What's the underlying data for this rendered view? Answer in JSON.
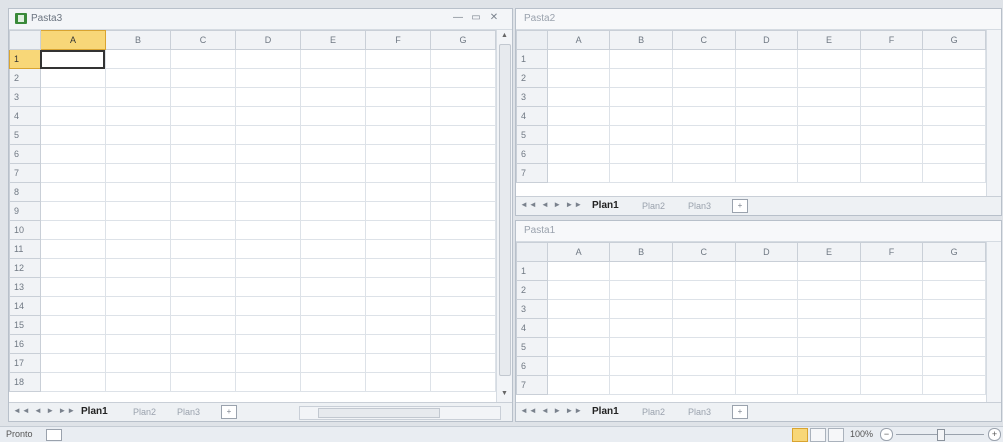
{
  "windows": [
    {
      "title": "Pasta3",
      "columns": [
        "A",
        "B",
        "C",
        "D",
        "E",
        "F",
        "G"
      ],
      "rows": [
        "1",
        "2",
        "3",
        "4",
        "5",
        "6",
        "7",
        "8",
        "9",
        "10",
        "11",
        "12",
        "13",
        "14",
        "15",
        "16",
        "17",
        "18"
      ],
      "sheet_tabs": [
        "Plan1",
        "Plan2",
        "Plan3"
      ],
      "active_tab": "Plan1",
      "selected_cell": "A1",
      "controls": {
        "minimize": "—",
        "restore": "▭",
        "close": "✕"
      }
    },
    {
      "title": "Pasta2",
      "columns": [
        "A",
        "B",
        "C",
        "D",
        "E",
        "F",
        "G"
      ],
      "rows": [
        "1",
        "2",
        "3",
        "4",
        "5",
        "6",
        "7"
      ],
      "sheet_tabs": [
        "Plan1",
        "Plan2",
        "Plan3"
      ],
      "active_tab": "Plan1"
    },
    {
      "title": "Pasta1",
      "columns": [
        "A",
        "B",
        "C",
        "D",
        "E",
        "F",
        "G"
      ],
      "rows": [
        "1",
        "2",
        "3",
        "4",
        "5",
        "6",
        "7"
      ],
      "sheet_tabs": [
        "Plan1",
        "Plan2",
        "Plan3"
      ],
      "active_tab": "Plan1"
    }
  ],
  "status": {
    "mode": "Pronto",
    "zoom": "100%",
    "zoom_minus": "−",
    "zoom_plus": "+"
  },
  "icons": {
    "tab_nav": "◄◄ ◄ ► ►►",
    "new_sheet": "insert-sheet-icon",
    "workbook": "excel-workbook-icon"
  },
  "colors": {
    "selected_header": "#f8d778",
    "workbook_icon": "#3a8a3a"
  }
}
